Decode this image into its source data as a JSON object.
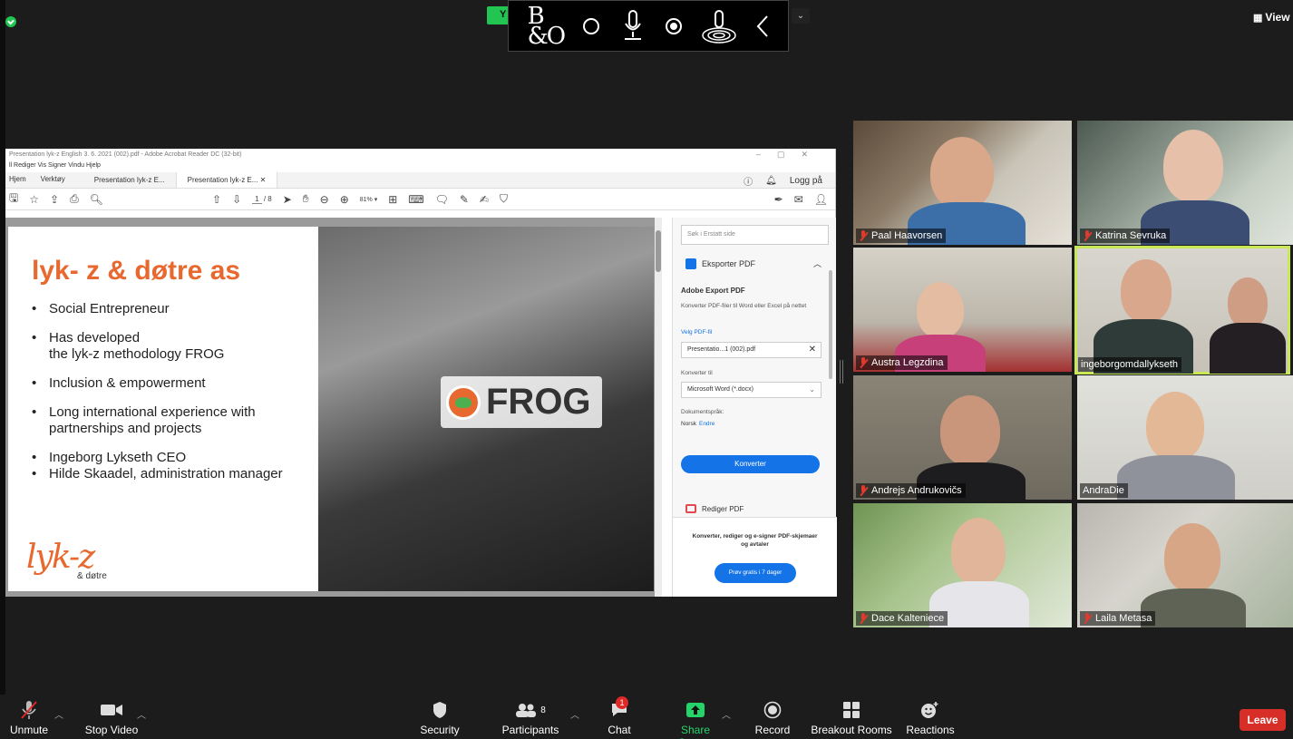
{
  "floating_bar": {
    "brand_glyph": "B&O"
  },
  "top_left_pill": "Y",
  "view_button": {
    "label": "View",
    "icon": "grid-icon"
  },
  "acrobat": {
    "window_title": "Presentation lyk-z English 3. 6. 2021 (002).pdf - Adobe Acrobat Reader DC (32-bit)",
    "menu": "ll  Rediger  Vis  Signer  Vindu  Hjelp",
    "nav_tabs": [
      "Hjem",
      "Verktøy"
    ],
    "doc_tabs": [
      "Presentation lyk-z E...",
      "Presentation lyk-z E..."
    ],
    "login": "Logg på",
    "page_current": "1",
    "page_total": "/ 8",
    "zoom": "81%"
  },
  "slide": {
    "title": "lyk- z & døtre as",
    "bullets": [
      "Social Entrepreneur",
      "Has developed\nthe lyk-z methodology FROG",
      "Inclusion & empowerment",
      "Long international experience with\npartnerships and projects",
      "Ingeborg Lykseth CEO",
      "Hilde Skaadel, administration manager"
    ],
    "logo_script": "lyk-z",
    "logo_sub": "& døtre",
    "frog_text": "FROG"
  },
  "side_panel": {
    "search_placeholder": "Søk i Erstatt side",
    "export_heading": "Eksporter PDF",
    "title": "Adobe Export PDF",
    "description": "Konverter PDF-filer til Word eller Excel på nettet",
    "choose_file": "Velg PDF-fil",
    "file_name": "Presentatio...1 (002).pdf",
    "convert_to_label": "Konverter til",
    "convert_to_value": "Microsoft Word (*.docx)",
    "doc_lang_label": "Dokumentspråk:",
    "doc_lang_value": "Norsk",
    "doc_lang_change": "Endre",
    "convert_button": "Konverter",
    "edit_heading": "Rediger PDF",
    "promo_text": "Konverter, rediger og e-signer PDF-skjemaer og avtaler",
    "promo_button": "Prøv gratis i 7 dager"
  },
  "participants_tiles": [
    {
      "name": "Paal Haavorsen",
      "muted": true
    },
    {
      "name": "Katrina Sevruka",
      "muted": true
    },
    {
      "name": "Austra Legzdina",
      "muted": true
    },
    {
      "name": "ingeborgomdallykseth",
      "muted": false,
      "active_speaker": true
    },
    {
      "name": "Andrejs Andrukovičs",
      "muted": true
    },
    {
      "name": "AndraDie",
      "muted": false
    },
    {
      "name": "Dace Kalteniece",
      "muted": true
    },
    {
      "name": "Laila Metasa",
      "muted": true
    }
  ],
  "toolbar": {
    "unmute": "Unmute",
    "stop_video": "Stop Video",
    "security": "Security",
    "participants": "Participants",
    "participant_count": "8",
    "chat": "Chat",
    "chat_badge": "1",
    "share_screen": "Share Screen",
    "record": "Record",
    "breakout_rooms": "Breakout Rooms",
    "reactions": "Reactions",
    "leave": "Leave"
  },
  "colors": {
    "accent_green": "#24d46a",
    "leave_red": "#d82e28",
    "slide_orange": "#e8692f",
    "adobe_blue": "#1473e6",
    "active_speaker_outline": "#c8e858"
  }
}
